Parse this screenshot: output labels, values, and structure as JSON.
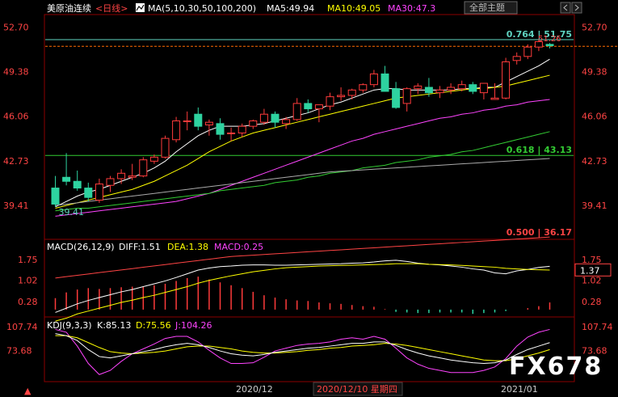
{
  "header": {
    "symbol": "美原油连续",
    "period": "<日线>",
    "ma_label": "MA(5,10,30,50,100,200)",
    "ma5": "MA5:49.94",
    "ma10": "MA10:49.05",
    "ma30": "MA30:47.3",
    "theme_button": "全部主题",
    "colors": {
      "ma5": "#ffffff",
      "ma10": "#ffff00",
      "ma30": "#ff44ff",
      "ma50": "#33cc33",
      "ma100": "#aaaaaa",
      "ma200": "#ff4444"
    }
  },
  "toolbar": {
    "box_icon": "chart-toggle-icon",
    "nav_left_icon": "chevron-left-icon",
    "nav_right_icon": "chevron-right-icon"
  },
  "macd": {
    "label": "MACD(26,12,9)",
    "diff": "DIFF:1.51",
    "dea": "DEA:1.38",
    "macd": "MACD:0.25",
    "current_tag": "1.37"
  },
  "kdj": {
    "label": "KDJ(9,3,3)",
    "k": "K:85.13",
    "d": "D:75.56",
    "j": "J:104.26"
  },
  "xaxis": {
    "left_marker": "▲",
    "ticks": [
      "2020/12",
      "2021/01"
    ],
    "cursor_label": "2020/12/10 星期四"
  },
  "watermark": "FX678",
  "chart_data": [
    {
      "type": "candlestick",
      "title": "美原油连续 日线",
      "y_ticks": [
        52.7,
        49.38,
        46.06,
        42.73,
        39.41
      ],
      "ylim": [
        37.0,
        53.5
      ],
      "ohlc": [
        [
          40.7,
          41.6,
          39.3,
          39.5
        ],
        [
          41.5,
          43.3,
          40.9,
          41.2
        ],
        [
          41.2,
          42.0,
          40.5,
          40.7
        ],
        [
          40.7,
          41.1,
          39.7,
          40.0
        ],
        [
          39.8,
          41.4,
          39.6,
          41.0
        ],
        [
          40.9,
          41.6,
          40.4,
          41.4
        ],
        [
          41.4,
          42.1,
          41.0,
          41.8
        ],
        [
          41.5,
          42.5,
          41.3,
          41.6
        ],
        [
          41.6,
          43.0,
          41.5,
          42.8
        ],
        [
          42.7,
          43.2,
          42.5,
          43.0
        ],
        [
          43.0,
          44.6,
          42.9,
          44.4
        ],
        [
          44.3,
          46.0,
          44.1,
          45.7
        ],
        [
          45.7,
          46.4,
          45.0,
          45.7
        ],
        [
          46.2,
          46.7,
          45.0,
          45.3
        ],
        [
          45.4,
          45.8,
          44.6,
          45.6
        ],
        [
          45.5,
          45.9,
          44.3,
          44.7
        ],
        [
          44.8,
          45.2,
          44.2,
          44.8
        ],
        [
          44.8,
          45.5,
          44.5,
          45.3
        ],
        [
          45.3,
          45.8,
          45.1,
          45.7
        ],
        [
          45.6,
          46.6,
          45.4,
          46.2
        ],
        [
          46.2,
          46.4,
          45.2,
          45.6
        ],
        [
          45.5,
          46.0,
          45.1,
          45.8
        ],
        [
          45.8,
          47.4,
          45.7,
          47.0
        ],
        [
          47.0,
          47.3,
          46.3,
          46.6
        ],
        [
          46.6,
          46.9,
          45.6,
          46.9
        ],
        [
          46.8,
          47.8,
          46.5,
          47.5
        ],
        [
          47.5,
          48.2,
          47.2,
          47.6
        ],
        [
          47.6,
          48.1,
          47.3,
          48.0
        ],
        [
          48.0,
          48.5,
          47.8,
          48.4
        ],
        [
          48.4,
          49.5,
          48.2,
          49.2
        ],
        [
          49.2,
          49.8,
          47.9,
          47.9
        ],
        [
          48.1,
          48.6,
          46.6,
          46.7
        ],
        [
          47.0,
          48.2,
          46.4,
          48.1
        ],
        [
          48.1,
          48.5,
          47.7,
          48.3
        ],
        [
          48.2,
          48.9,
          47.5,
          47.8
        ],
        [
          47.8,
          48.3,
          47.4,
          48.0
        ],
        [
          48.0,
          48.5,
          47.7,
          48.2
        ],
        [
          48.1,
          48.7,
          47.9,
          48.4
        ],
        [
          48.4,
          48.6,
          47.7,
          47.9
        ],
        [
          47.8,
          48.1,
          47.3,
          48.5
        ],
        [
          47.3,
          48.5,
          47.3,
          47.4
        ],
        [
          47.4,
          50.4,
          47.3,
          50.1
        ],
        [
          50.2,
          50.8,
          49.9,
          50.5
        ],
        [
          50.5,
          51.4,
          50.3,
          51.2
        ],
        [
          51.2,
          51.8,
          50.9,
          51.6
        ],
        [
          51.4,
          51.5,
          51.1,
          51.3
        ]
      ],
      "moving_averages": {
        "MA5": [
          39.3,
          39.7,
          40.1,
          40.4,
          40.6,
          40.9,
          41.2,
          41.5,
          41.8,
          42.2,
          42.7,
          43.4,
          44.0,
          44.6,
          45.0,
          45.3,
          45.3,
          45.3,
          45.4,
          45.5,
          45.7,
          45.9,
          46.1,
          46.3,
          46.6,
          46.9,
          47.1,
          47.4,
          47.7,
          48.0,
          48.1,
          48.1,
          48.0,
          48.0,
          48.0,
          48.0,
          48.0,
          48.1,
          48.1,
          48.2,
          48.2,
          48.6,
          49.0,
          49.4,
          49.8,
          50.3
        ],
        "MA10": [
          39.2,
          39.4,
          39.6,
          39.8,
          40.0,
          40.2,
          40.4,
          40.6,
          40.9,
          41.2,
          41.6,
          42.0,
          42.4,
          42.9,
          43.4,
          43.8,
          44.2,
          44.5,
          44.8,
          45.0,
          45.2,
          45.4,
          45.6,
          45.8,
          46.0,
          46.2,
          46.4,
          46.6,
          46.8,
          47.0,
          47.2,
          47.4,
          47.5,
          47.6,
          47.7,
          47.8,
          47.9,
          48.0,
          48.1,
          48.1,
          48.2,
          48.3,
          48.5,
          48.7,
          48.9,
          49.1
        ],
        "MA30": [
          38.6,
          38.7,
          38.8,
          38.9,
          39.0,
          39.1,
          39.2,
          39.3,
          39.4,
          39.5,
          39.6,
          39.7,
          39.9,
          40.1,
          40.3,
          40.6,
          40.9,
          41.2,
          41.5,
          41.8,
          42.1,
          42.4,
          42.7,
          43.0,
          43.3,
          43.6,
          43.9,
          44.2,
          44.4,
          44.7,
          44.9,
          45.1,
          45.3,
          45.5,
          45.7,
          45.9,
          46.0,
          46.2,
          46.3,
          46.5,
          46.6,
          46.8,
          46.9,
          47.1,
          47.2,
          47.3
        ],
        "MA50": [
          39.0,
          39.1,
          39.2,
          39.2,
          39.3,
          39.4,
          39.5,
          39.6,
          39.7,
          39.8,
          39.9,
          40.0,
          40.1,
          40.2,
          40.3,
          40.5,
          40.6,
          40.7,
          40.8,
          40.9,
          41.1,
          41.2,
          41.3,
          41.5,
          41.6,
          41.8,
          41.9,
          42.0,
          42.2,
          42.3,
          42.4,
          42.6,
          42.7,
          42.8,
          43.0,
          43.1,
          43.2,
          43.4,
          43.5,
          43.7,
          43.9,
          44.1,
          44.3,
          44.5,
          44.7,
          44.9
        ],
        "MA100": [
          39.4,
          39.5,
          39.6,
          39.7,
          39.8,
          39.9,
          40.0,
          40.1,
          40.2,
          40.3,
          40.4,
          40.5,
          40.6,
          40.7,
          40.8,
          40.9,
          41.0,
          41.1,
          41.2,
          41.3,
          41.4,
          41.5,
          41.6,
          41.7,
          41.8,
          41.9,
          41.95,
          42.0,
          42.05,
          42.1,
          42.15,
          42.2,
          42.25,
          42.3,
          42.35,
          42.4,
          42.45,
          42.5,
          42.55,
          42.6,
          42.65,
          42.7,
          42.75,
          42.8,
          42.85,
          42.9
        ],
        "MA200": [
          34.0,
          34.1,
          34.2,
          34.3,
          34.4,
          34.5,
          34.6,
          34.7,
          34.8,
          34.9,
          35.0,
          35.1,
          35.2,
          35.3,
          35.4,
          35.5,
          35.6,
          35.65,
          35.7,
          35.75,
          35.8,
          35.85,
          35.9,
          35.95,
          36.0,
          36.05,
          36.1,
          36.15,
          36.2,
          36.25,
          36.3,
          36.35,
          36.4,
          36.45,
          36.5,
          36.55,
          36.6,
          36.65,
          36.7,
          36.75,
          36.8,
          36.85,
          36.9,
          36.95,
          37.0,
          37.05
        ]
      },
      "fib_levels": [
        {
          "label": "0.764 | 51.75",
          "value": 51.75,
          "color": "#5fd3c0"
        },
        {
          "label": "0.618 | 43.13",
          "value": 43.13,
          "color": "#33cc33"
        },
        {
          "label": "0.500 | 36.17",
          "value": 36.17,
          "color": "#ff4444"
        }
      ],
      "annotations": [
        {
          "label": "39.41",
          "value": 39.41
        },
        {
          "label": "51.26",
          "value": 51.26
        }
      ],
      "dashed_price_line": 51.26
    },
    {
      "type": "bar",
      "title": "MACD(26,12,9)",
      "y_ticks": [
        1.75,
        1.02,
        0.28
      ],
      "ylim": [
        -0.2,
        2.0
      ],
      "macd_hist": [
        0.4,
        0.6,
        0.7,
        0.75,
        0.72,
        0.75,
        0.78,
        0.8,
        0.8,
        0.85,
        0.9,
        1.0,
        1.1,
        1.15,
        1.05,
        0.95,
        0.85,
        0.75,
        0.62,
        0.5,
        0.42,
        0.36,
        0.32,
        0.3,
        0.25,
        0.22,
        0.2,
        0.16,
        0.12,
        0.1,
        0.02,
        -0.08,
        -0.1,
        -0.12,
        -0.12,
        -0.1,
        -0.1,
        -0.1,
        -0.15,
        -0.12,
        -0.1,
        -0.05,
        0.0,
        0.05,
        0.12,
        0.25
      ],
      "diff": [
        -0.1,
        0.05,
        0.2,
        0.32,
        0.42,
        0.52,
        0.62,
        0.7,
        0.8,
        0.9,
        1.0,
        1.12,
        1.25,
        1.38,
        1.45,
        1.5,
        1.52,
        1.55,
        1.56,
        1.56,
        1.55,
        1.55,
        1.56,
        1.57,
        1.58,
        1.59,
        1.6,
        1.62,
        1.63,
        1.66,
        1.7,
        1.72,
        1.68,
        1.62,
        1.58,
        1.56,
        1.52,
        1.48,
        1.42,
        1.38,
        1.28,
        1.25,
        1.35,
        1.4,
        1.47,
        1.51
      ],
      "dea": [
        -0.4,
        -0.3,
        -0.15,
        -0.05,
        0.05,
        0.15,
        0.25,
        0.33,
        0.42,
        0.5,
        0.6,
        0.7,
        0.8,
        0.92,
        1.02,
        1.1,
        1.18,
        1.25,
        1.32,
        1.37,
        1.42,
        1.46,
        1.48,
        1.5,
        1.52,
        1.53,
        1.54,
        1.55,
        1.56,
        1.57,
        1.58,
        1.6,
        1.6,
        1.6,
        1.58,
        1.57,
        1.56,
        1.54,
        1.52,
        1.5,
        1.48,
        1.44,
        1.42,
        1.4,
        1.39,
        1.38
      ]
    },
    {
      "type": "line",
      "title": "KDJ(9,3,3)",
      "y_ticks": [
        107.74,
        73.68
      ],
      "ylim": [
        30,
        115
      ],
      "K": [
        98,
        95,
        88,
        75,
        65,
        63,
        66,
        69,
        72,
        75,
        79,
        82,
        84,
        82,
        78,
        73,
        69,
        67,
        66,
        68,
        71,
        73,
        75,
        77,
        78,
        80,
        82,
        84,
        84,
        86,
        86,
        81,
        75,
        70,
        66,
        63,
        60,
        58,
        56,
        55,
        56,
        60,
        68,
        75,
        80,
        85
      ],
      "D": [
        95,
        95,
        92,
        85,
        78,
        72,
        70,
        69,
        70,
        71,
        73,
        76,
        79,
        80,
        80,
        78,
        76,
        73,
        71,
        70,
        70,
        71,
        72,
        74,
        75,
        77,
        78,
        80,
        81,
        82,
        84,
        83,
        81,
        78,
        75,
        72,
        69,
        66,
        63,
        60,
        59,
        59,
        62,
        66,
        70,
        75
      ],
      "J": [
        104,
        100,
        80,
        55,
        39,
        45,
        58,
        69,
        76,
        83,
        91,
        94,
        94,
        86,
        74,
        63,
        55,
        55,
        56,
        64,
        73,
        77,
        81,
        83,
        84,
        86,
        90,
        92,
        90,
        94,
        90,
        77,
        63,
        54,
        48,
        45,
        42,
        42,
        42,
        45,
        50,
        62,
        80,
        93,
        100,
        104
      ]
    }
  ]
}
